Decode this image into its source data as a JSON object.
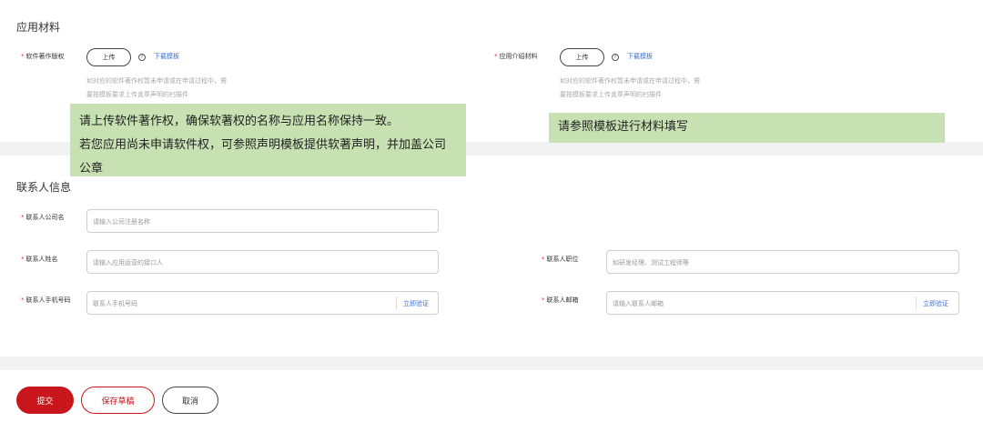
{
  "materials": {
    "title": "应用材料",
    "software_copyright": {
      "label": "软件著作版权",
      "upload": "上传",
      "help": "?",
      "download": "下载模板",
      "hint_line1": "如对应的软件著作权暂未申请或在申请过程中，需",
      "hint_line2": "要按模板要求上传盖章声明的扫描件"
    },
    "app_intro": {
      "label": "应用介绍材料",
      "upload": "上传",
      "help": "?",
      "download": "下载模板",
      "hint_line1": "如对应的软件著作权暂未申请或在申请过程中，需",
      "hint_line2": "要按模板要求上传盖章声明的扫描件"
    }
  },
  "annotations": {
    "left_line1": "请上传软件著作权，确保软著权的名称与应用名称保持一致。",
    "left_line2": "若您应用尚未申请软件权，可参照声明模板提供软著声明，并加盖公司",
    "left_line3": "公章",
    "right": "请参照模板进行材料填写"
  },
  "contact": {
    "title": "联系人信息",
    "company": {
      "label": "联系人公司名",
      "placeholder": "请输入公司注册名称"
    },
    "name": {
      "label": "联系人姓名",
      "placeholder": "请输入应用运营的接口人"
    },
    "position": {
      "label": "联系人职位",
      "placeholder": "如研发经理、测试工程师等"
    },
    "phone": {
      "label": "联系人手机号码",
      "placeholder": "联系人手机号码",
      "verify": "立即验证"
    },
    "email": {
      "label": "联系人邮箱",
      "placeholder": "请输入联系人邮箱",
      "verify": "立即验证"
    },
    "required_mark": "*"
  },
  "actions": {
    "submit": "提交",
    "save_draft": "保存草稿",
    "cancel": "取消"
  },
  "colors": {
    "primary": "#c9161c",
    "link": "#3b6fd0",
    "annotation_bg": "#c7e1b3"
  }
}
